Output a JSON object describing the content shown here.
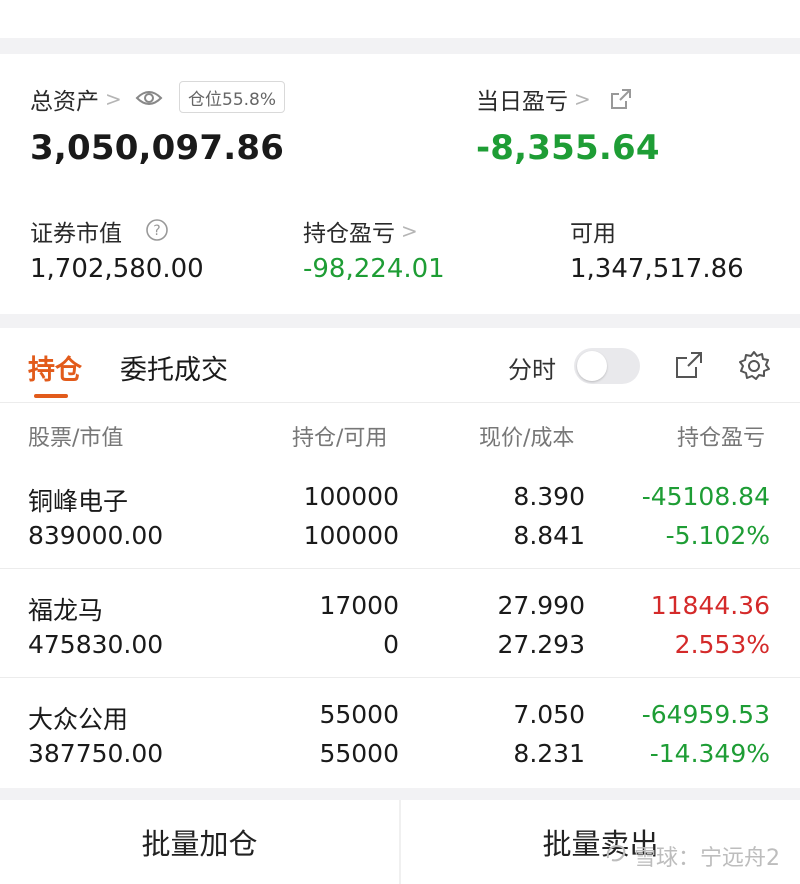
{
  "top_tabs": [
    "",
    "",
    "",
    "",
    ""
  ],
  "summary": {
    "total_assets_label": "总资产",
    "position_badge": "仓位55.8%",
    "total_assets_value": "3,050,097.86",
    "daily_pnl_label": "当日盈亏",
    "daily_pnl_value": "-8,355.64",
    "market_value_label": "证券市值",
    "market_value": "1,702,580.00",
    "holding_pnl_label": "持仓盈亏",
    "holding_pnl_value": "-98,224.01",
    "available_label": "可用",
    "available_value": "1,347,517.86"
  },
  "tabs": {
    "positions": "持仓",
    "orders": "委托成交",
    "intraday_label": "分时"
  },
  "table": {
    "headers": [
      "股票/市值",
      "持仓/可用",
      "现价/成本",
      "持仓盈亏"
    ],
    "rows": [
      {
        "name": "铜峰电子",
        "market_value": "839000.00",
        "position": "100000",
        "available": "100000",
        "price": "8.390",
        "cost": "8.841",
        "pnl": "-45108.84",
        "pnl_pct": "-5.102%",
        "trend": "down"
      },
      {
        "name": "福龙马",
        "market_value": "475830.00",
        "position": "17000",
        "available": "0",
        "price": "27.990",
        "cost": "27.293",
        "pnl": "11844.36",
        "pnl_pct": "2.553%",
        "trend": "up"
      },
      {
        "name": "大众公用",
        "market_value": "387750.00",
        "position": "55000",
        "available": "55000",
        "price": "7.050",
        "cost": "8.231",
        "pnl": "-64959.53",
        "pnl_pct": "-14.349%",
        "trend": "down"
      }
    ]
  },
  "bottom": {
    "batch_add": "批量加仓",
    "batch_sell": "批量卖出"
  },
  "watermark": "雪球：宁远舟2",
  "colors": {
    "accent": "#e25b1b",
    "up": "#d42a2a",
    "down": "#1e9d35"
  }
}
